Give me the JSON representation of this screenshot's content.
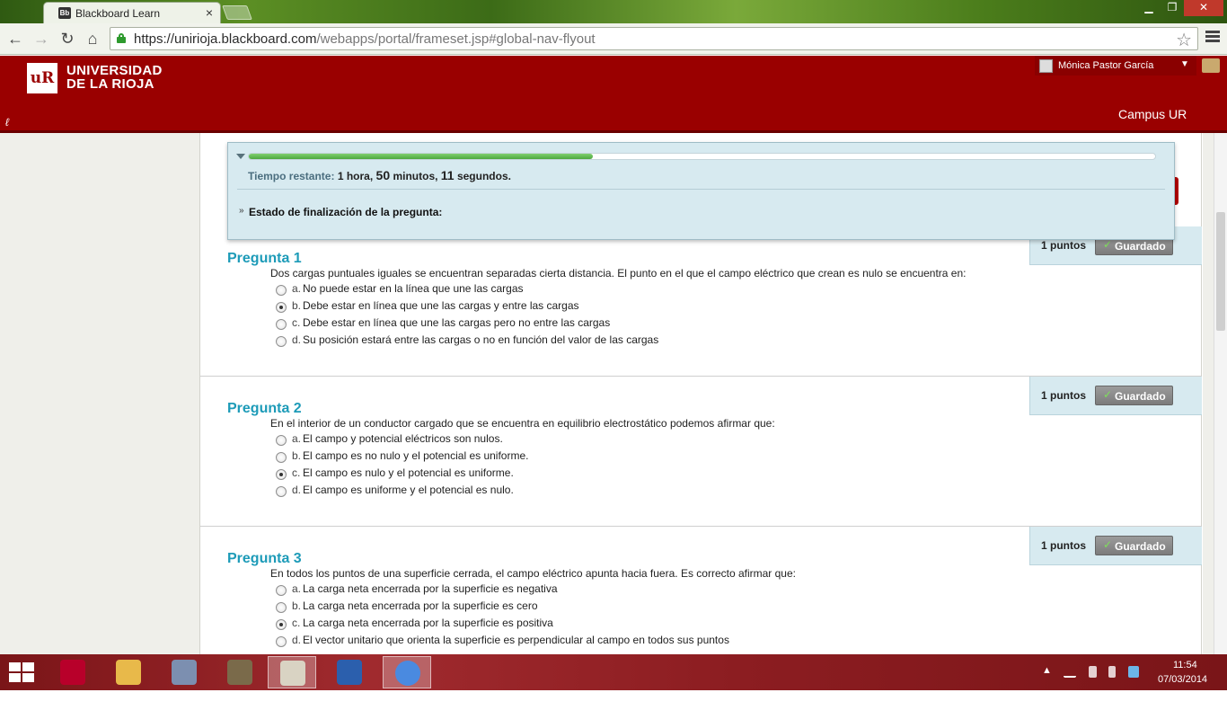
{
  "browser": {
    "tab_title": "Blackboard Learn",
    "favicon": "Bb",
    "url_host": "https://unirioja.blackboard.com",
    "url_path": "/webapps/portal/frameset.jsp#global-nav-flyout"
  },
  "header": {
    "logo_line1": "UNIVERSIDAD",
    "logo_line2": "DE LA RIOJA",
    "user_name": "Mónica Pastor García",
    "campus_link": "Campus UR",
    "brand_color": "#9a0000"
  },
  "timer": {
    "remaining_label": "Tiempo restante:",
    "hours": "1",
    "hours_unit": "hora,",
    "minutes": "50",
    "minutes_unit": "minutos,",
    "seconds": "11",
    "seconds_unit": "segundos.",
    "progress": 0.38,
    "status_label": "Estado de finalización de la pregunta:"
  },
  "questions": [
    {
      "title": "Pregunta 1",
      "points": "1 puntos",
      "saved": "Guardado",
      "text": "Dos cargas puntuales iguales se encuentran separadas cierta distancia. El punto en el que el campo eléctrico que crean es nulo se encuentra en:",
      "selected": 1,
      "options": [
        {
          "letter": "a.",
          "text": "No puede estar en la línea que une las cargas"
        },
        {
          "letter": "b.",
          "text": "Debe estar en línea que une las cargas y entre las cargas"
        },
        {
          "letter": "c.",
          "text": "Debe estar en línea que une las cargas pero no entre las cargas"
        },
        {
          "letter": "d.",
          "text": "Su posición estará entre las cargas o no en función del valor de las cargas"
        }
      ]
    },
    {
      "title": "Pregunta 2",
      "points": "1 puntos",
      "saved": "Guardado",
      "text": "En el interior de un conductor cargado que se encuentra en equilibrio electrostático podemos afirmar que:",
      "selected": 2,
      "options": [
        {
          "letter": "a.",
          "text": "El campo y potencial eléctricos son nulos."
        },
        {
          "letter": "b.",
          "text": "El campo es no nulo y el potencial es uniforme."
        },
        {
          "letter": "c.",
          "text": "El campo es nulo y el potencial es uniforme."
        },
        {
          "letter": "d.",
          "text": "El campo es uniforme y el potencial es nulo."
        }
      ]
    },
    {
      "title": "Pregunta 3",
      "points": "1 puntos",
      "saved": "Guardado",
      "text": "En todos los puntos de una superficie cerrada, el campo eléctrico apunta hacia fuera. Es correcto afirmar que:",
      "selected": 2,
      "options": [
        {
          "letter": "a.",
          "text": "La carga neta encerrada por la superficie es negativa"
        },
        {
          "letter": "b.",
          "text": "La carga neta encerrada por la superficie es cero"
        },
        {
          "letter": "c.",
          "text": "La carga neta encerrada por la superficie es positiva"
        },
        {
          "letter": "d.",
          "text": "El vector unitario que orienta la superficie es perpendicular al campo en todos sus puntos"
        }
      ]
    }
  ],
  "taskbar": {
    "apps": [
      "power-icon",
      "file-explorer-icon",
      "video-editor-icon",
      "gimp-icon",
      "paint-icon",
      "word-icon",
      "chrome-icon"
    ],
    "time": "11:54",
    "date": "07/03/2014"
  }
}
